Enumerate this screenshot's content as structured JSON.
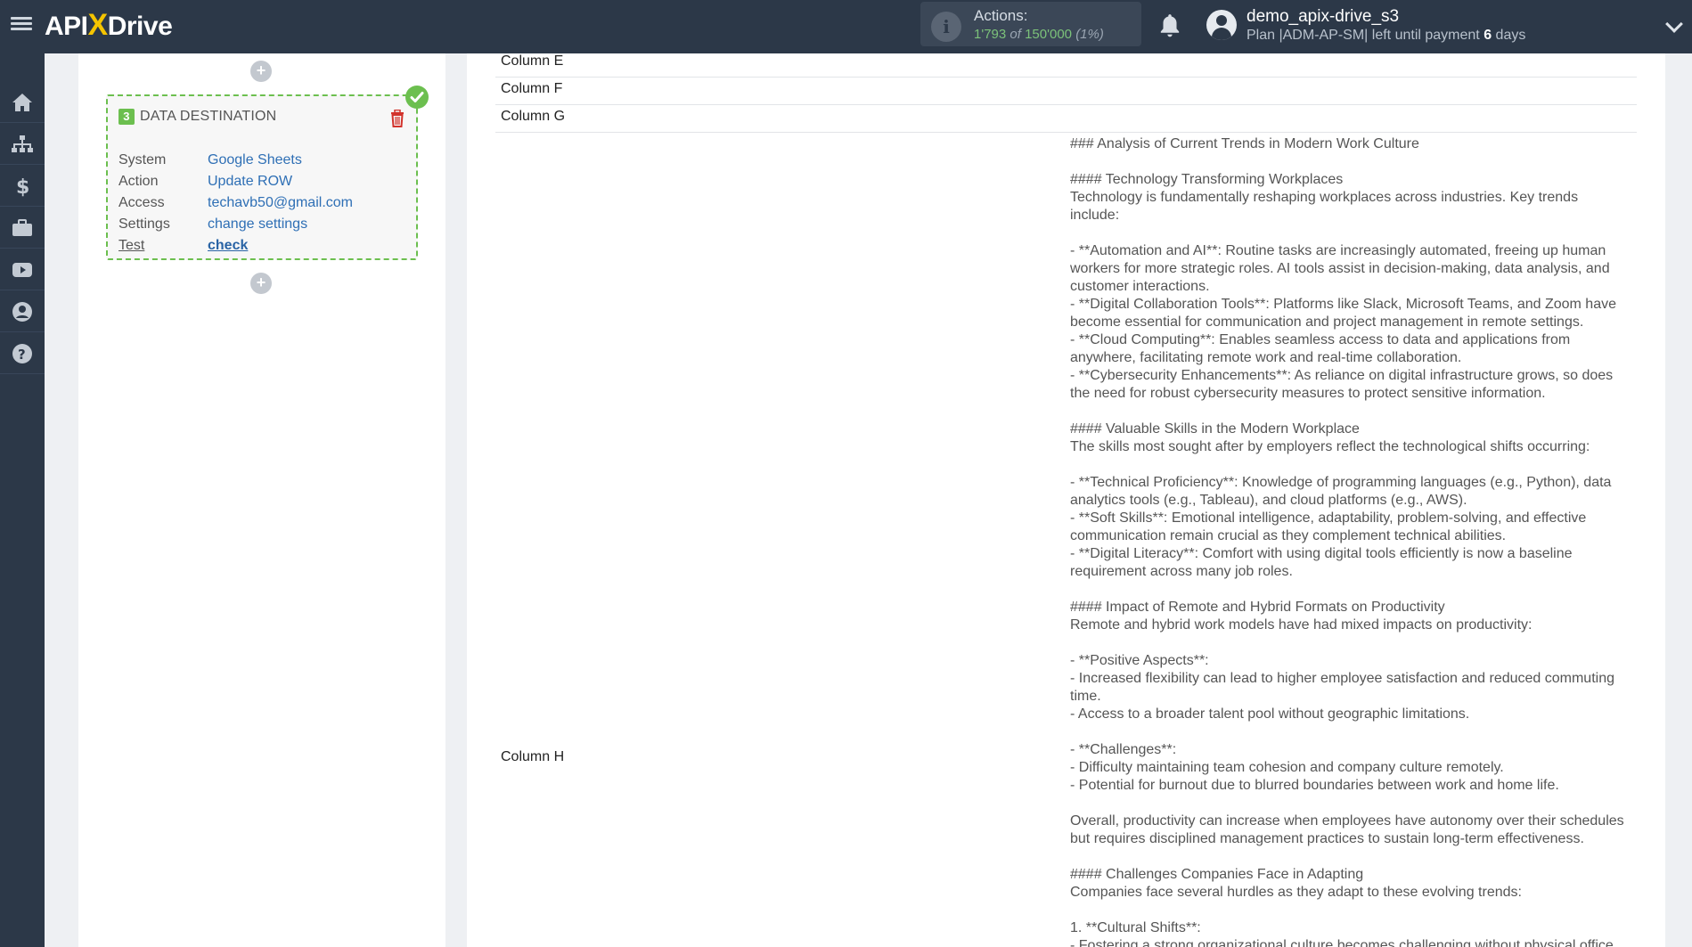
{
  "header": {
    "logo_api": "API",
    "logo_x": "X",
    "logo_drive": "Drive",
    "actions_label": "Actions:",
    "actions_used": "1'793",
    "actions_of": "of",
    "actions_total": "150'000",
    "actions_pct": "(1%)",
    "user_name": "demo_apix-drive_s3",
    "plan_text": "Plan |ADM-AP-SM| left until payment",
    "plan_days": "6",
    "plan_days_suffix": "days"
  },
  "sidebar": {
    "items": [
      "home-icon",
      "sitemap-icon",
      "dollar-icon",
      "briefcase-icon",
      "video-icon",
      "user-icon",
      "help-icon"
    ]
  },
  "destination": {
    "number": "3",
    "title": "DATA DESTINATION",
    "rows": [
      {
        "key": "System",
        "value": "Google Sheets"
      },
      {
        "key": "Action",
        "value": "Update ROW"
      },
      {
        "key": "Access",
        "value": "techavb50@gmail.com"
      },
      {
        "key": "Settings",
        "value": "change settings"
      },
      {
        "key": "Test",
        "value": "check"
      }
    ]
  },
  "columns": {
    "e": "Column E",
    "f": "Column F",
    "g": "Column G",
    "h": "Column H"
  },
  "content_lines": [
    "### Analysis of Current Trends in Modern Work Culture",
    "",
    "#### Technology Transforming Workplaces",
    "Technology is fundamentally reshaping workplaces across industries. Key trends include:",
    "",
    "- **Automation and AI**: Routine tasks are increasingly automated, freeing up human workers for more strategic roles. AI tools assist in decision-making, data analysis, and customer interactions.",
    "- **Digital Collaboration Tools**: Platforms like Slack, Microsoft Teams, and Zoom have become essential for communication and project management in remote settings.",
    "- **Cloud Computing**: Enables seamless access to data and applications from anywhere, facilitating remote work and real-time collaboration.",
    "- **Cybersecurity Enhancements**: As reliance on digital infrastructure grows, so does the need for robust cybersecurity measures to protect sensitive information.",
    "",
    "#### Valuable Skills in the Modern Workplace",
    "The skills most sought after by employers reflect the technological shifts occurring:",
    "",
    "- **Technical Proficiency**: Knowledge of programming languages (e.g., Python), data analytics tools (e.g., Tableau), and cloud platforms (e.g., AWS).",
    "- **Soft Skills**: Emotional intelligence, adaptability, problem-solving, and effective communication remain crucial as they complement technical abilities.",
    "- **Digital Literacy**: Comfort with using digital tools efficiently is now a baseline requirement across many job roles.",
    "",
    "#### Impact of Remote and Hybrid Formats on Productivity",
    "Remote and hybrid work models have had mixed impacts on productivity:",
    "",
    "- **Positive Aspects**:",
    "- Increased flexibility can lead to higher employee satisfaction and reduced commuting time.",
    "- Access to a broader talent pool without geographic limitations.",
    "",
    "- **Challenges**:",
    "- Difficulty maintaining team cohesion and company culture remotely.",
    "- Potential for burnout due to blurred boundaries between work and home life.",
    "",
    "Overall, productivity can increase when employees have autonomy over their schedules but requires disciplined management practices to sustain long-term effectiveness.",
    "",
    "#### Challenges Companies Face in Adapting",
    "Companies face several hurdles as they adapt to these evolving trends:",
    "",
    "1. **Cultural Shifts**:",
    "- Fostering a strong organizational culture becomes challenging without physical office"
  ]
}
